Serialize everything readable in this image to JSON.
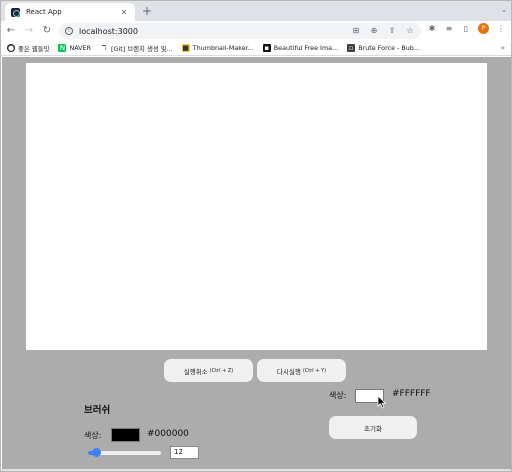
{
  "browser": {
    "tab": {
      "title": "React App",
      "favicon": "react-icon"
    },
    "address": {
      "url": "localhost:3000"
    },
    "bookmarks": [
      {
        "label": "좋은 웹들밋",
        "icon": "github-icon",
        "color": "#202124"
      },
      {
        "label": "NAVER",
        "icon": "naver-icon",
        "color": "#03c75a"
      },
      {
        "label": "[Git] 브랜치 생성 및...",
        "icon": "git-icon",
        "color": "#555555"
      },
      {
        "label": "Thumbnail-Maker...",
        "icon": "thumbnail-icon",
        "color": "#f4c542"
      },
      {
        "label": "Beautiful Free Ima...",
        "icon": "unsplash-icon",
        "color": "#111111"
      },
      {
        "label": "Brute Force - Bub...",
        "icon": "bookmark-page-icon",
        "color": "#3c4043"
      }
    ],
    "profile_initial": "P"
  },
  "app": {
    "undo": {
      "label": "실행취소",
      "shortcut": "(Ctrl + Z)"
    },
    "redo": {
      "label": "다시실행",
      "shortcut": "(Ctrl + Y)"
    },
    "brush": {
      "title": "브러쉬",
      "color_label": "색상:",
      "color": "#000000",
      "color_hex": "#000000",
      "size": 12,
      "size_min": 1,
      "size_max": 100
    },
    "background": {
      "color_label": "색상:",
      "color": "#FFFFFF",
      "color_hex": "#FFFFFF"
    },
    "reset": {
      "label": "초기화"
    },
    "colors": {
      "page_bg": "#adacac",
      "slider_accent": "#3b82f6"
    }
  }
}
